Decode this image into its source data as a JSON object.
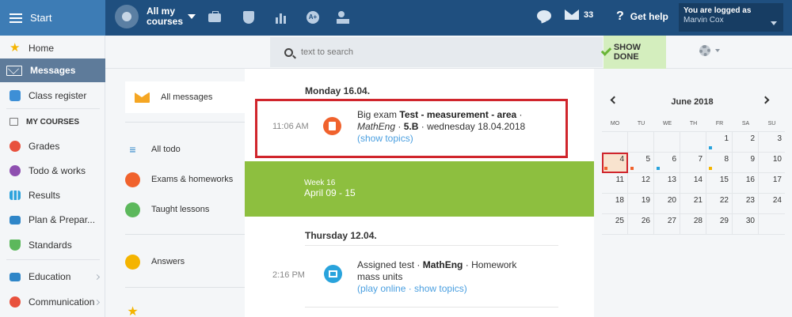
{
  "topbar": {
    "start_label": "Start",
    "courses_label": "All my courses",
    "mail_count": "33",
    "help_label": "Get help",
    "logged_as": "You are logged as",
    "user_name": "Marvin Cox",
    "icons": [
      "briefcase-icon",
      "shield-icon",
      "bar-chart-icon",
      "grade-a-plus-icon",
      "teacher-icon",
      "chat-icon",
      "mail-icon",
      "help-icon"
    ]
  },
  "sidebar": {
    "home": "Home",
    "messages": "Messages",
    "class_register": "Class register",
    "my_courses": "MY COURSES",
    "grades": "Grades",
    "todo": "Todo & works",
    "results": "Results",
    "plan": "Plan & Prepar...",
    "standards": "Standards",
    "education": "Education",
    "communication": "Communication"
  },
  "search": {
    "placeholder": "text to search",
    "show_done": "SHOW DONE"
  },
  "categories": {
    "all_messages": "All messages",
    "all_todo": "All todo",
    "exams": "Exams & homeworks",
    "taught": "Taught lessons",
    "answers": "Answers"
  },
  "feed": {
    "day1": "Monday 16.04.",
    "msg1": {
      "time": "11:06 AM",
      "type": "Big exam",
      "title": "Test - measurement - area",
      "subject": "MathEng",
      "class": "5.B",
      "date": "wednesday 18.04.2018",
      "link": "(show topics)"
    },
    "week": {
      "label": "Week 16",
      "range": "April 09 - 15"
    },
    "day2": "Thursday 12.04.",
    "msg2": {
      "time": "2:16 PM",
      "type": "Assigned test",
      "subject": "MathEng",
      "kind": "Homework",
      "title": "mass units",
      "link": "(play online · show topics)"
    }
  },
  "calendar": {
    "title": "June 2018",
    "days_of_week": [
      "MO",
      "TU",
      "WE",
      "TH",
      "FR",
      "SA",
      "SU"
    ],
    "weeks": [
      [
        "",
        "",
        "",
        "",
        "1",
        "2",
        "3"
      ],
      [
        "4",
        "5",
        "6",
        "7",
        "8",
        "9",
        "10"
      ],
      [
        "11",
        "12",
        "13",
        "14",
        "15",
        "16",
        "17"
      ],
      [
        "18",
        "19",
        "20",
        "21",
        "22",
        "23",
        "24"
      ],
      [
        "25",
        "26",
        "27",
        "28",
        "29",
        "30",
        ""
      ]
    ],
    "today": "4",
    "event_dots": {
      "1": "#29a3dc",
      "4": "#f0622d",
      "5": "#f0622d",
      "6": "#29a3dc",
      "8": "#f4b400"
    }
  },
  "colors": {
    "topbar": "#1f4f7f",
    "accent_blue": "#3d7cb5",
    "week_band": "#8dbf3f",
    "highlight": "#d0252c",
    "link": "#4a9fe0"
  }
}
